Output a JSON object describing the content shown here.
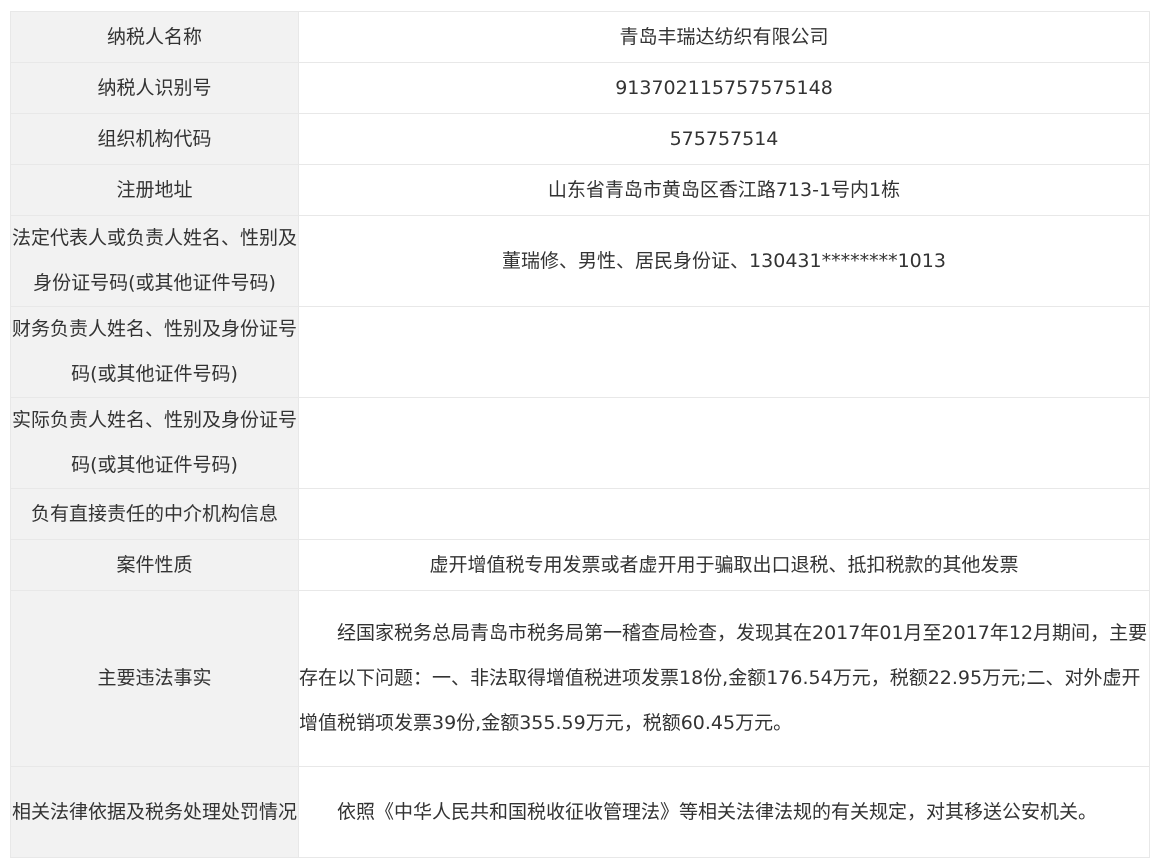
{
  "rows": [
    {
      "label": "纳税人名称",
      "value": "青岛丰瑞达纺织有限公司"
    },
    {
      "label": "纳税人识别号",
      "value": "913702115757575148"
    },
    {
      "label": "组织机构代码",
      "value": "575757514"
    },
    {
      "label": "注册地址",
      "value": "山东省青岛市黄岛区香江路713-1号内1栋"
    },
    {
      "label": "法定代表人或负责人姓名、性别及身份证号码(或其他证件号码)",
      "value": "董瑞修、男性、居民身份证、130431********1013"
    },
    {
      "label": "财务负责人姓名、性别及身份证号码(或其他证件号码)",
      "value": ""
    },
    {
      "label": "实际负责人姓名、性别及身份证号码(或其他证件号码)",
      "value": ""
    },
    {
      "label": "负有直接责任的中介机构信息",
      "value": ""
    },
    {
      "label": "案件性质",
      "value": "虚开增值税专用发票或者虚开用于骗取出口退税、抵扣税款的其他发票"
    },
    {
      "label": "主要违法事实",
      "value": "经国家税务总局青岛市税务局第一稽查局检查，发现其在2017年01月至2017年12月期间，主要存在以下问题：一、非法取得增值税进项发票18份,金额176.54万元，税额22.95万元;二、对外虚开增值税销项发票39份,金额355.59万元，税额60.45万元。"
    },
    {
      "label": "相关法律依据及税务处理处罚情况",
      "value": "依照《中华人民共和国税收征收管理法》等相关法律法规的有关规定，对其移送公安机关。"
    }
  ]
}
